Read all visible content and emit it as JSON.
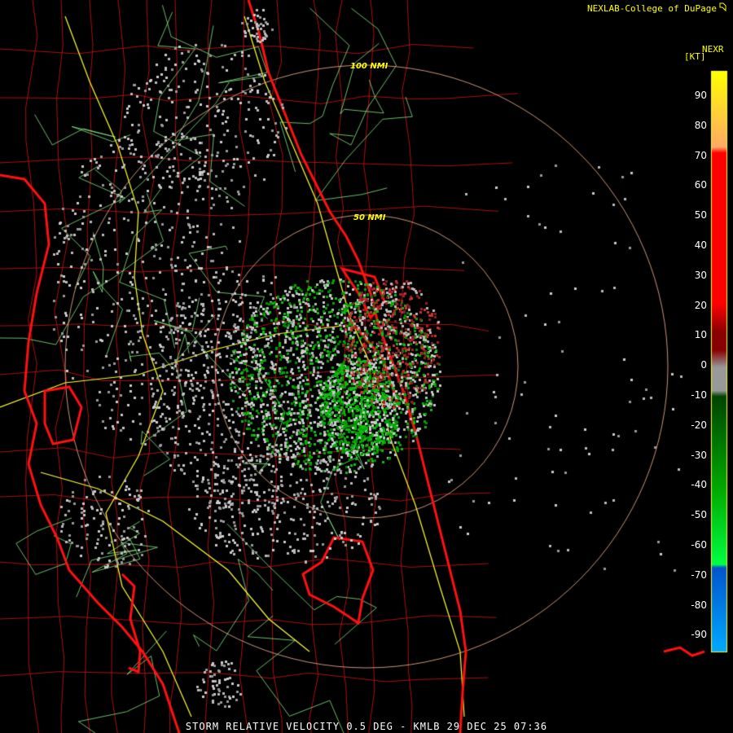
{
  "header": {
    "credit": "NEXLAB-College of DuPage",
    "credit_logo_icon": "cod-logo-icon"
  },
  "legend": {
    "title": "NEXR",
    "unit": "[KT]",
    "ticks": [
      "90",
      "80",
      "70",
      "60",
      "50",
      "40",
      "30",
      "20",
      "10",
      "0",
      "-10",
      "-20",
      "-30",
      "-40",
      "-50",
      "-60",
      "-70",
      "-80",
      "-90"
    ],
    "colors": {
      "top_yellow": "#ffff00",
      "orange": "#ffaa66",
      "red": "#ff0000",
      "dark_red": "#880000",
      "gray": "#999999",
      "green": "#00aa00",
      "bright_green": "#00ff44",
      "blue": "#0055cc",
      "light_blue": "#00aaff"
    }
  },
  "range_rings": [
    "100 NMI",
    "50 NMI"
  ],
  "footer": {
    "product": "STORM RELATIVE VELOCITY 0.5 DEG - KMLB 29 DEC 25 07:36"
  },
  "map_colors": {
    "coastline": "#ff1111",
    "county_lines": "#aa1111",
    "highways": "#ffff33",
    "roads": "#88ee88",
    "rings": "#ffbb99"
  }
}
